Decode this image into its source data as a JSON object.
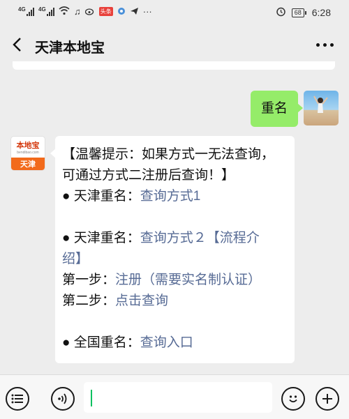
{
  "status_bar": {
    "signal1_label": "4G",
    "signal2_label": "4G",
    "toutiao_label": "头条",
    "battery_level": "68",
    "time": "6:28",
    "icons": [
      "signal-icon",
      "signal-icon",
      "wifi-icon",
      "music-icon",
      "weibo-icon",
      "toutiao-icon",
      "browser-icon",
      "telegram-icon",
      "more-dots-icon",
      "alarm-icon",
      "battery-icon"
    ]
  },
  "nav": {
    "title": "天津本地宝"
  },
  "messages": {
    "user": {
      "text": "重名"
    },
    "bot": {
      "avatar_top": "本地宝",
      "avatar_sub": "bendibao.com",
      "avatar_bottom": "天津",
      "line1": "【温馨提示：如果方式一无法查询，",
      "line2": "可通过方式二注册后查询！】",
      "item1_prefix": "● 天津重名：",
      "item1_link": "查询方式1",
      "item2_prefix": "● 天津重名：",
      "item2_link": "查询方式２【流程介",
      "item2_link_cont": "绍】",
      "step1_prefix": "第一步：",
      "step1_link": "注册（需要实名制认证）",
      "step2_prefix": "第二步：",
      "step2_link": "点击查询",
      "item3_prefix": "● 全国重名：",
      "item3_link": "查询入口"
    }
  },
  "input_bar": {
    "placeholder": ""
  },
  "colors": {
    "background": "#ededed",
    "my_bubble": "#95ec69",
    "link": "#576b95",
    "caret": "#07c160"
  }
}
